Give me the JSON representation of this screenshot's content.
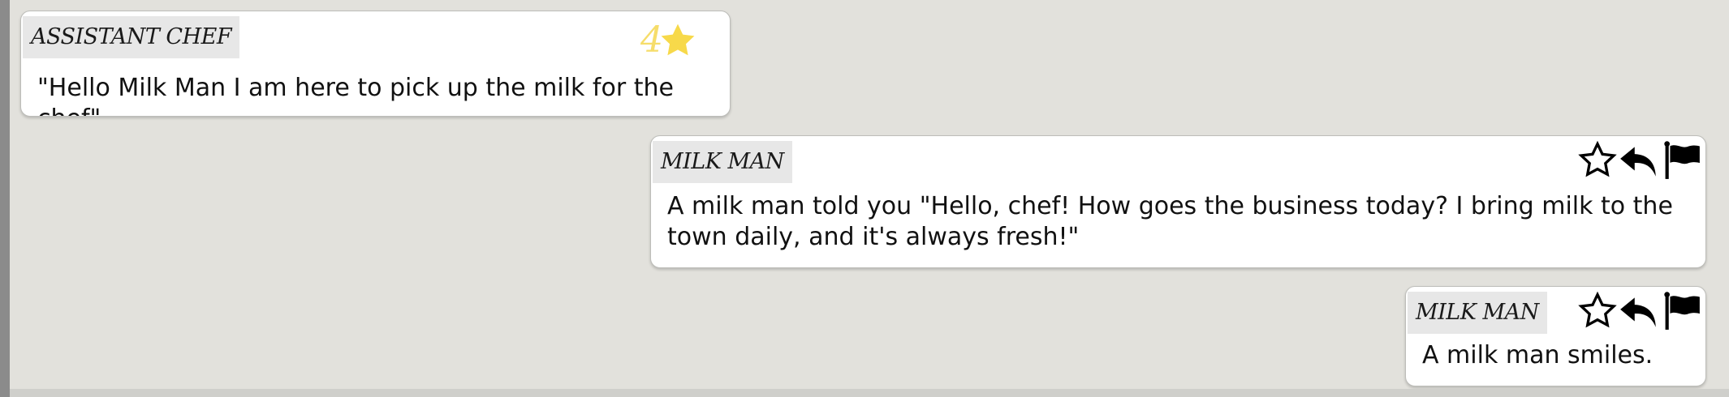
{
  "colors": {
    "background": "#e2e1dc",
    "bubble": "#ffffff",
    "speaker_tag": "#e7e7e7",
    "rating_star": "#f7d94a"
  },
  "messages": [
    {
      "speaker": "ASSISTANT CHEF",
      "text": "\"Hello Milk Man I am here to pick up the milk for the chef\"",
      "rating": "4",
      "rating_icon": "filled-star-icon"
    },
    {
      "speaker": "MILK MAN",
      "text": "A milk man told you \"Hello, chef! How goes the business today? I bring milk to the town daily, and it's always fresh!\"",
      "actions": [
        "star-outline-icon",
        "reply-icon",
        "flag-icon"
      ]
    },
    {
      "speaker": "MILK MAN",
      "text": "A milk man smiles.",
      "actions": [
        "star-outline-icon",
        "reply-icon",
        "flag-icon"
      ]
    }
  ]
}
